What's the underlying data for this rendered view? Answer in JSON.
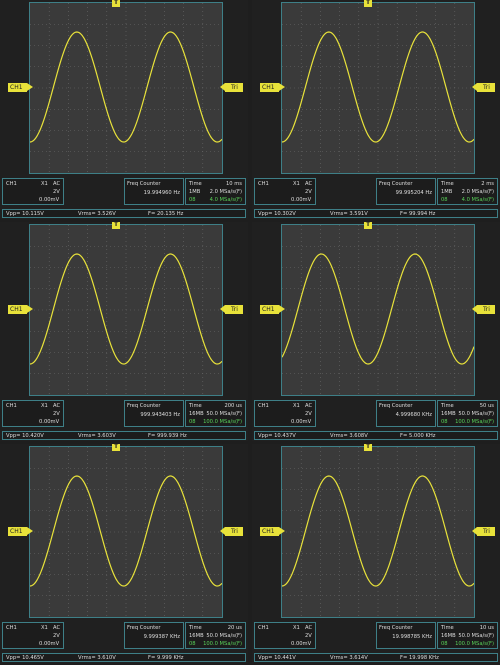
{
  "labels": {
    "ch1": "CH1",
    "probe": "X1",
    "coupling": "AC",
    "volts_div": "2V",
    "offset": "0.00mV",
    "freq_counter": "Freq Counter",
    "time": "Time",
    "trig_tag": "Tri",
    "trig_marker": "T"
  },
  "colors": {
    "trace": "#e8e23a",
    "grid_frame": "#3e7f87",
    "accent_green": "#58d058"
  },
  "panels": [
    {
      "freq_counter_value": "19.994960 Hz",
      "time_div": "10 ms",
      "mem_depth": "1MB",
      "sample_rate_1": "2.0 MSa/s(F)",
      "sample_label": "08",
      "sample_rate_2": "4.0 MSa/s(F)",
      "vpp": "Vpp= 10.115V",
      "vrms": "Vrms= 3.526V",
      "freq": "F= 20.135 Hz"
    },
    {
      "freq_counter_value": "99.995204 Hz",
      "time_div": "2 ms",
      "mem_depth": "1MB",
      "sample_rate_1": "2.0 MSa/s(F)",
      "sample_label": "08",
      "sample_rate_2": "4.0 MSa/s(F)",
      "vpp": "Vpp= 10.302V",
      "vrms": "Vrms= 3.591V",
      "freq": "F= 99.994 Hz"
    },
    {
      "freq_counter_value": "999.943403 Hz",
      "time_div": "200 us",
      "mem_depth": "16MB",
      "sample_rate_1": "50.0 MSa/s(F)",
      "sample_label": "08",
      "sample_rate_2": "100.0 MSa/s(F)",
      "vpp": "Vpp= 10.420V",
      "vrms": "Vrms= 3.603V",
      "freq": "F= 999.939 Hz"
    },
    {
      "freq_counter_value": "4.999680 KHz",
      "time_div": "50 us",
      "mem_depth": "16MB",
      "sample_rate_1": "50.0 MSa/s(F)",
      "sample_label": "08",
      "sample_rate_2": "100.0 MSa/s(F)",
      "vpp": "Vpp= 10.437V",
      "vrms": "Vrms= 3.608V",
      "freq": "F= 5.000 KHz"
    },
    {
      "freq_counter_value": "9.999387 KHz",
      "time_div": "20 us",
      "mem_depth": "16MB",
      "sample_rate_1": "50.0 MSa/s(F)",
      "sample_label": "08",
      "sample_rate_2": "100.0 MSa/s(F)",
      "vpp": "Vpp= 10.465V",
      "vrms": "Vrms= 3.610V",
      "freq": "F= 9.999 KHz"
    },
    {
      "freq_counter_value": "19.998785 KHz",
      "time_div": "10 us",
      "mem_depth": "16MB",
      "sample_rate_1": "50.0 MSa/s(F)",
      "sample_label": "08",
      "sample_rate_2": "100.0 MSa/s(F)",
      "vpp": "Vpp= 10.441V",
      "vrms": "Vrms= 3.614V",
      "freq": "F= 19.998 KHz"
    }
  ]
}
